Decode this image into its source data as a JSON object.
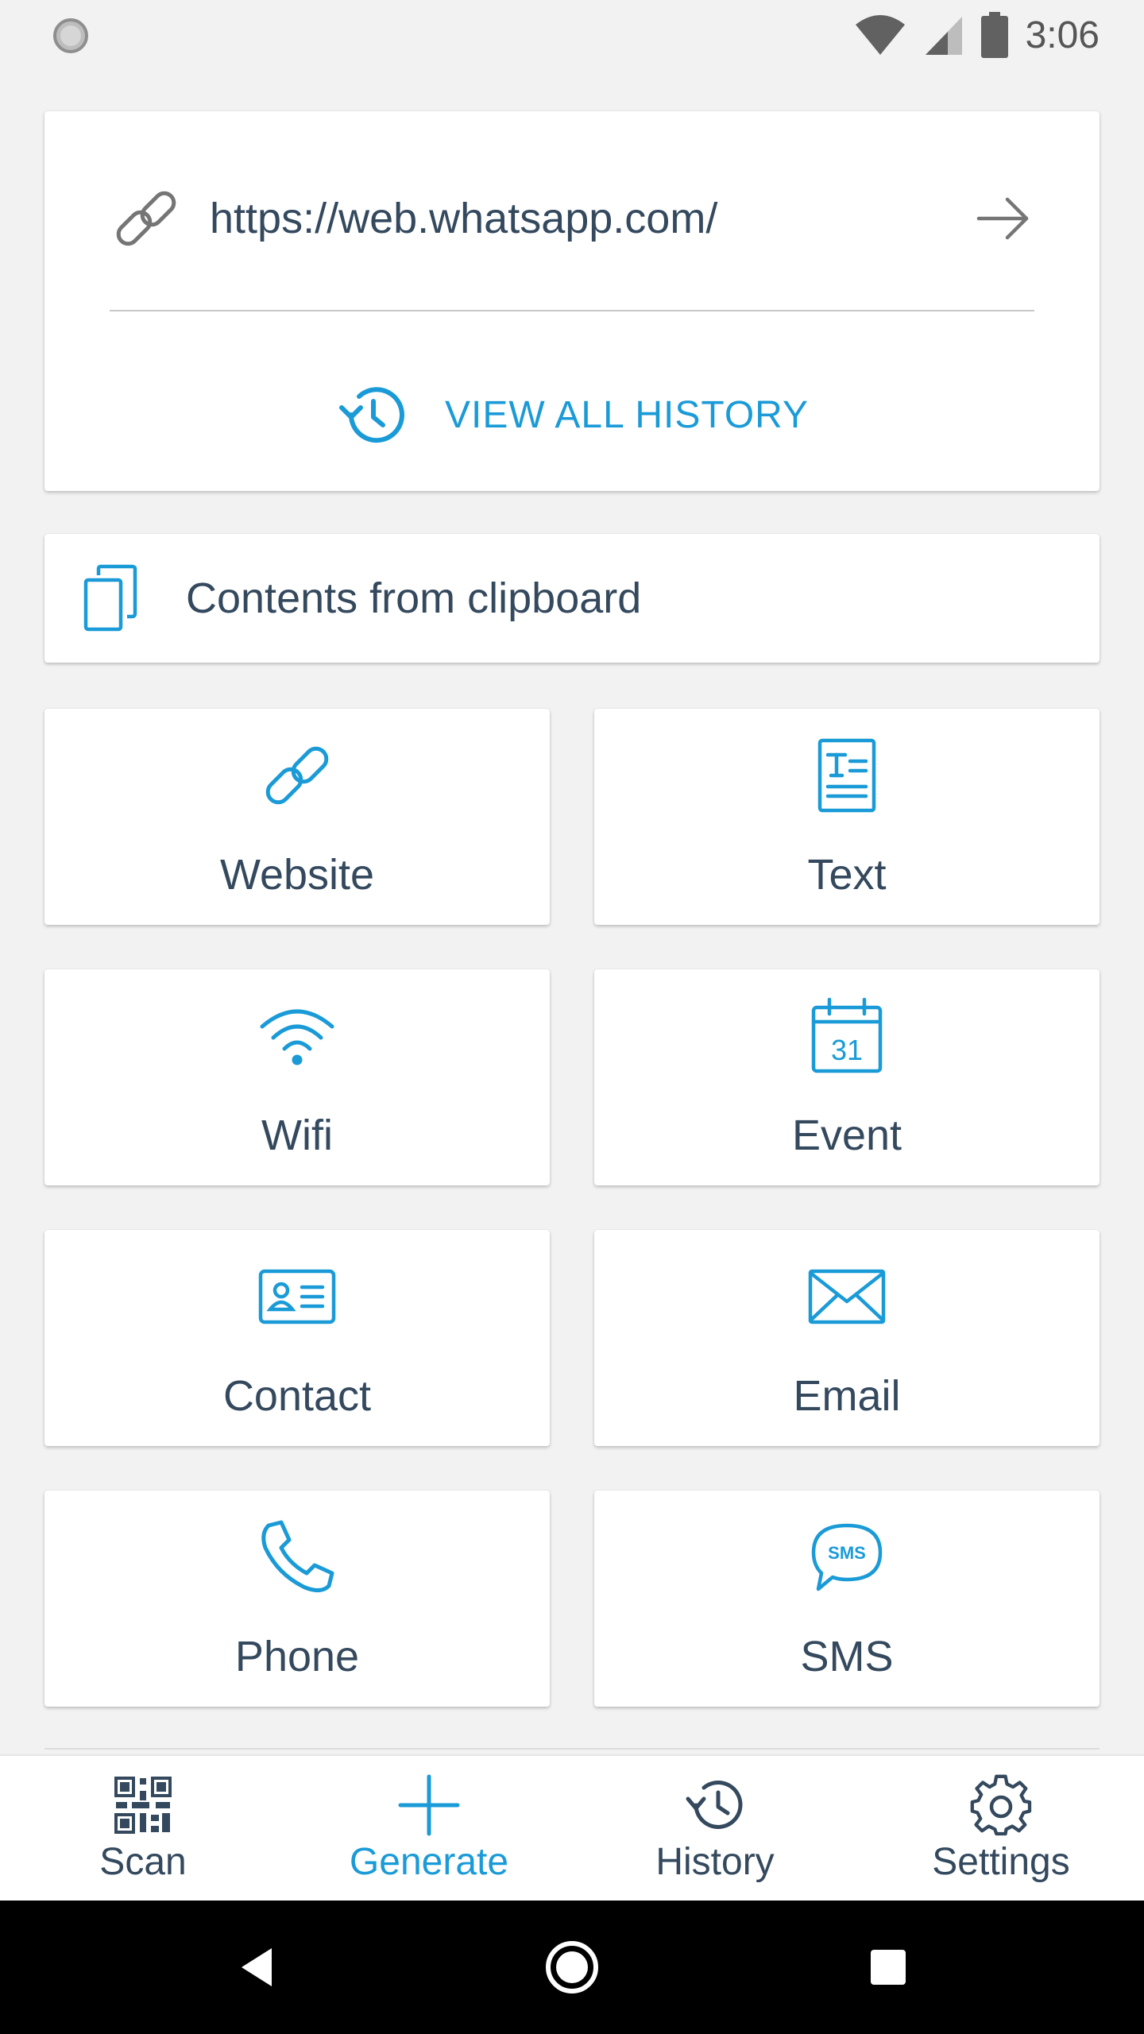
{
  "status_bar": {
    "time": "3:06"
  },
  "url_card": {
    "url": "https://web.whatsapp.com/",
    "history_link_label": "VIEW ALL HISTORY"
  },
  "clipboard": {
    "label": "Contents from clipboard"
  },
  "tiles": {
    "website": "Website",
    "text": "Text",
    "wifi": "Wifi",
    "event": "Event",
    "event_day": "31",
    "contact": "Contact",
    "email": "Email",
    "phone": "Phone",
    "sms": "SMS",
    "sms_badge": "SMS"
  },
  "bottom_nav": {
    "scan": "Scan",
    "generate": "Generate",
    "history": "History",
    "settings": "Settings"
  },
  "colors": {
    "accent": "#1a9bd7",
    "text": "#34495e",
    "background": "#f2f2f2"
  }
}
